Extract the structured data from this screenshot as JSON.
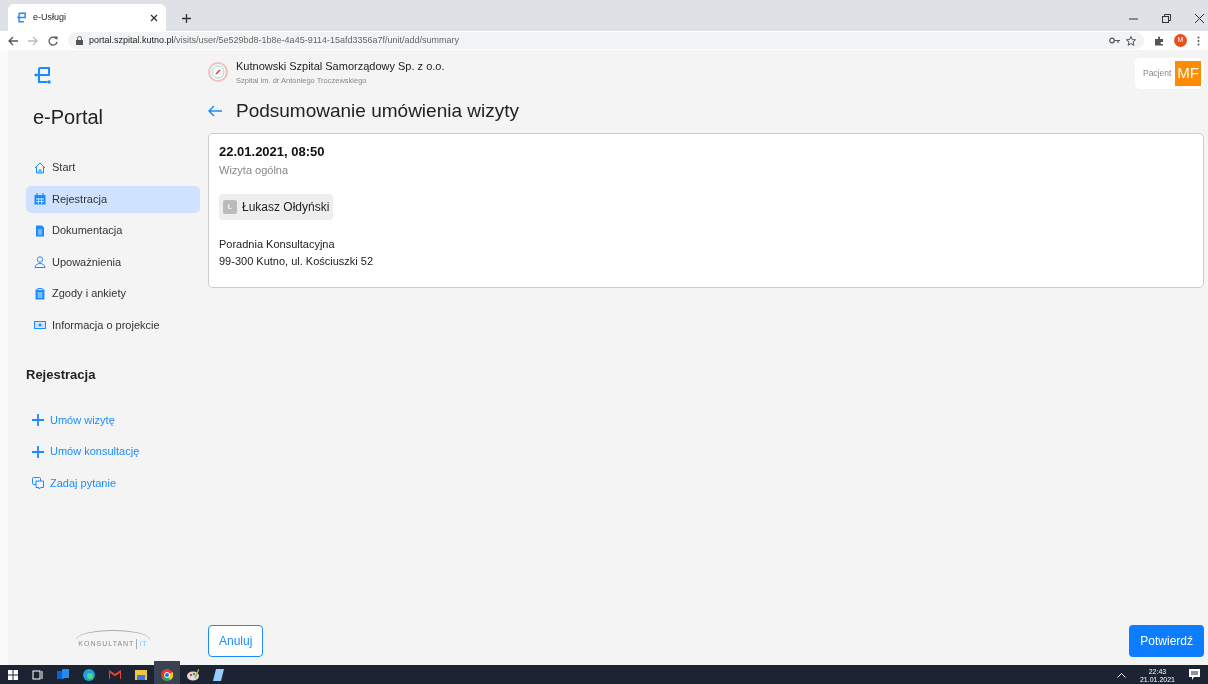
{
  "browser": {
    "tab_title": "e-Usługi",
    "url_host": "portal.szpital.kutno.pl",
    "url_path": "/visits/user/5e529bd8-1b8e-4a45-9114-15afd3356a7f/unit/add/summary",
    "profile_initial": "M"
  },
  "sidebar": {
    "brand": "e-Portal",
    "items": [
      {
        "label": "Start",
        "selected": false
      },
      {
        "label": "Rejestracja",
        "selected": true
      },
      {
        "label": "Dokumentacja",
        "selected": false
      },
      {
        "label": "Upoważnienia",
        "selected": false
      },
      {
        "label": "Zgody i ankiety",
        "selected": false
      },
      {
        "label": "Informacja o projekcie",
        "selected": false
      }
    ],
    "section_title": "Rejestracja",
    "actions": [
      {
        "label": "Umów wizytę"
      },
      {
        "label": "Umów konsultację"
      },
      {
        "label": "Zadaj pytanie"
      }
    ],
    "footer_logo": {
      "name": "KONSULTANT",
      "suffix": "IT"
    }
  },
  "header": {
    "org_name": "Kutnowski Szpital Samorządowy Sp. z o.o.",
    "org_subtitle": "Szpital im. dr Antoniego Troczewskiego",
    "user_label": "Pacjent",
    "user_initials": "MF"
  },
  "page_title": "Podsumowanie umówienia wizyty",
  "visit": {
    "datetime": "22.01.2021, 08:50",
    "type": "Wizyta ogólna",
    "doctor_initial": "Ł",
    "doctor_name": "Łukasz Ołdyński",
    "clinic": "Poradnia Konsultacyjna",
    "address": "99-300 Kutno, ul. Kościuszki 52"
  },
  "buttons": {
    "cancel": "Anuluj",
    "confirm": "Potwierdź"
  },
  "taskbar": {
    "time": "22:43",
    "date": "21.01.2021"
  }
}
